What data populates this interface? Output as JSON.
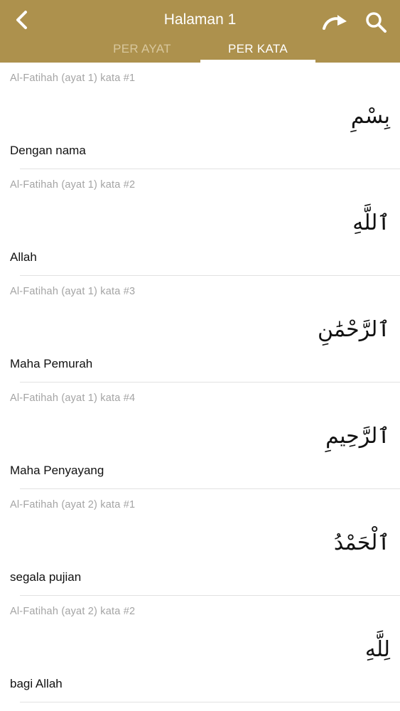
{
  "header": {
    "title": "Halaman 1",
    "background_color": "#ad914d",
    "back_icon": "chevron-left-icon",
    "jump_icon": "curved-arrow-icon",
    "search_icon": "search-icon"
  },
  "tabs": [
    {
      "label": "PER AYAT",
      "active": false
    },
    {
      "label": "PER KATA",
      "active": true
    }
  ],
  "items": [
    {
      "ref": "Al-Fatihah (ayat 1) kata #1",
      "arabic": "بِسْمِ",
      "meaning": "Dengan nama"
    },
    {
      "ref": "Al-Fatihah (ayat 1) kata #2",
      "arabic": "ٱللَّهِ",
      "meaning": "Allah"
    },
    {
      "ref": "Al-Fatihah (ayat 1) kata #3",
      "arabic": "ٱلرَّحْمَٰنِ",
      "meaning": "Maha Pemurah"
    },
    {
      "ref": "Al-Fatihah (ayat 1) kata #4",
      "arabic": "ٱلرَّحِيمِ",
      "meaning": "Maha Penyayang"
    },
    {
      "ref": "Al-Fatihah (ayat 2) kata #1",
      "arabic": "ٱلْحَمْدُ",
      "meaning": "segala pujian"
    },
    {
      "ref": "Al-Fatihah (ayat 2) kata #2",
      "arabic": "لِلَّهِ",
      "meaning": "bagi Allah"
    }
  ]
}
